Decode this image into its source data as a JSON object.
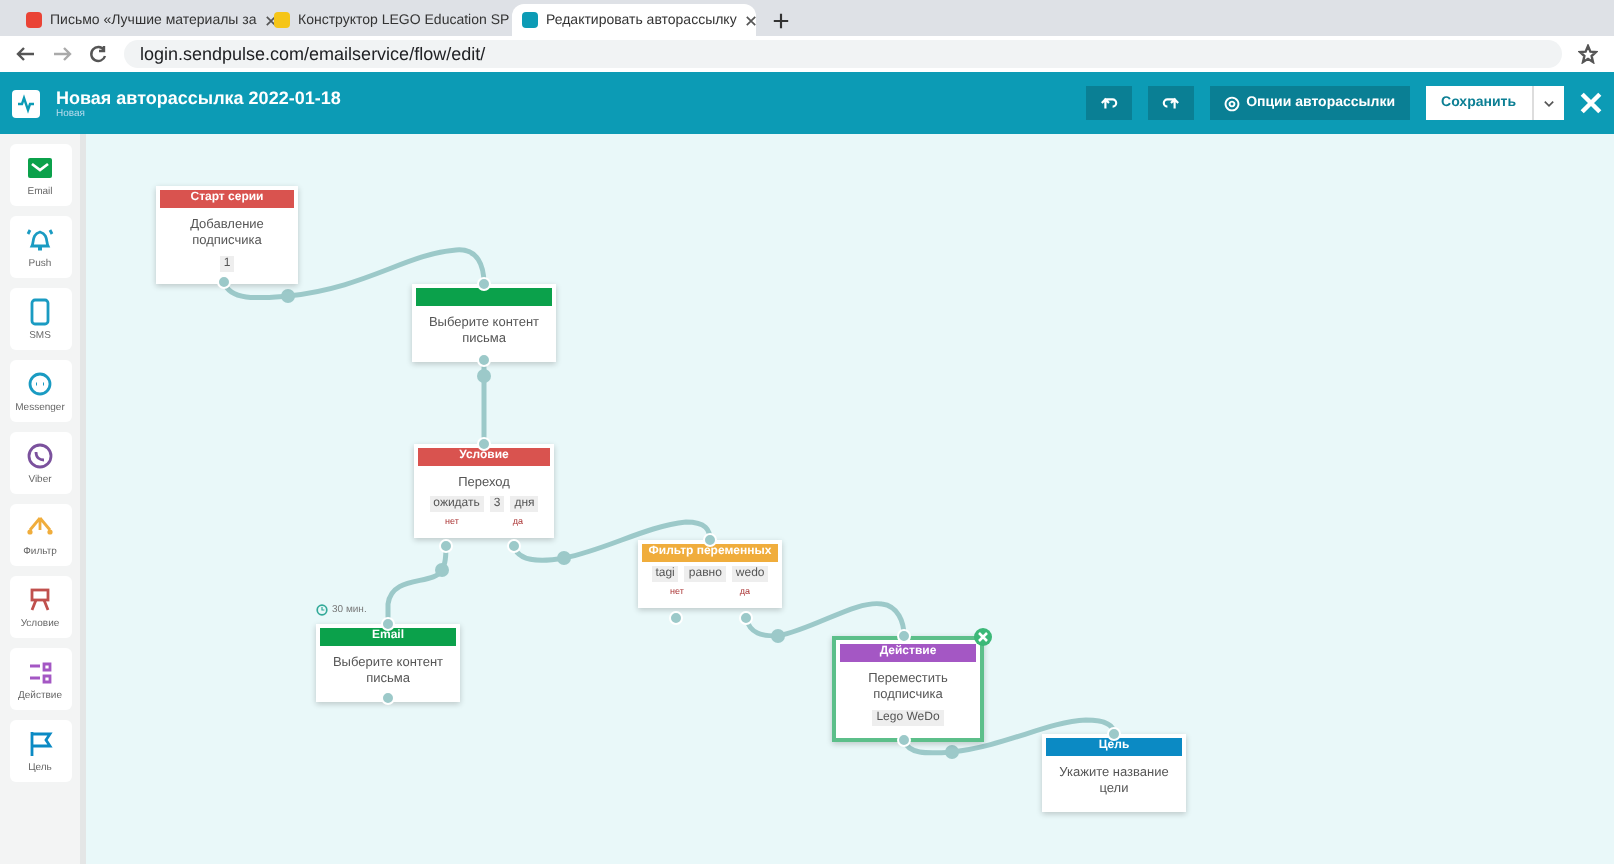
{
  "browser": {
    "tabs": [
      {
        "title": "Письмо «Лучшие материалы за",
        "selected": false
      },
      {
        "title": "Конструктор LEGO Education SP",
        "selected": false
      },
      {
        "title": "Редактировать авторассылку",
        "selected": true
      }
    ],
    "url": "login.sendpulse.com/emailservice/flow/edit/"
  },
  "header": {
    "title": "Новая авторассылка 2022-01-18",
    "subtitle": "Новая",
    "options_button": "Опции авторассылки",
    "save_button": "Сохранить"
  },
  "sidebar": {
    "items": [
      {
        "kind": "email",
        "label": "Email"
      },
      {
        "kind": "push",
        "label": "Push"
      },
      {
        "kind": "sms",
        "label": "SMS"
      },
      {
        "kind": "messenger",
        "label": "Messenger"
      },
      {
        "kind": "viber",
        "label": "Viber"
      },
      {
        "kind": "filter",
        "label": "Фильтр"
      },
      {
        "kind": "condition",
        "label": "Условие"
      },
      {
        "kind": "action",
        "label": "Действие"
      },
      {
        "kind": "goal",
        "label": "Цель"
      }
    ]
  },
  "flow": {
    "nodes": [
      {
        "kind": "start",
        "title": "Старт серии",
        "text": "Добавление подписчика",
        "tags": [
          "1"
        ],
        "selected": false
      },
      {
        "kind": "email",
        "text": "Выберите контент письма",
        "selected": false
      },
      {
        "kind": "condition",
        "title": "Условие",
        "text": "Переход",
        "tags": [
          "ожидать",
          "3",
          "дня"
        ],
        "branches": [
          "нет",
          "да"
        ],
        "selected": false
      },
      {
        "kind": "filter",
        "title": "Фильтр переменных",
        "tags": [
          "tagi",
          "равно",
          "wedo"
        ],
        "branches": [
          "нет",
          "да"
        ],
        "selected": false
      },
      {
        "kind": "email",
        "title": "Email",
        "delay": "30 мин.",
        "text": "Выберите контент письма",
        "selected": false
      },
      {
        "kind": "action",
        "title": "Действие",
        "text": "Переместить подписчика",
        "tags": [
          "Lego WeDo"
        ],
        "selected": true
      },
      {
        "kind": "goal",
        "title": "Цель",
        "text": "Укажите название цели",
        "selected": false
      }
    ]
  }
}
